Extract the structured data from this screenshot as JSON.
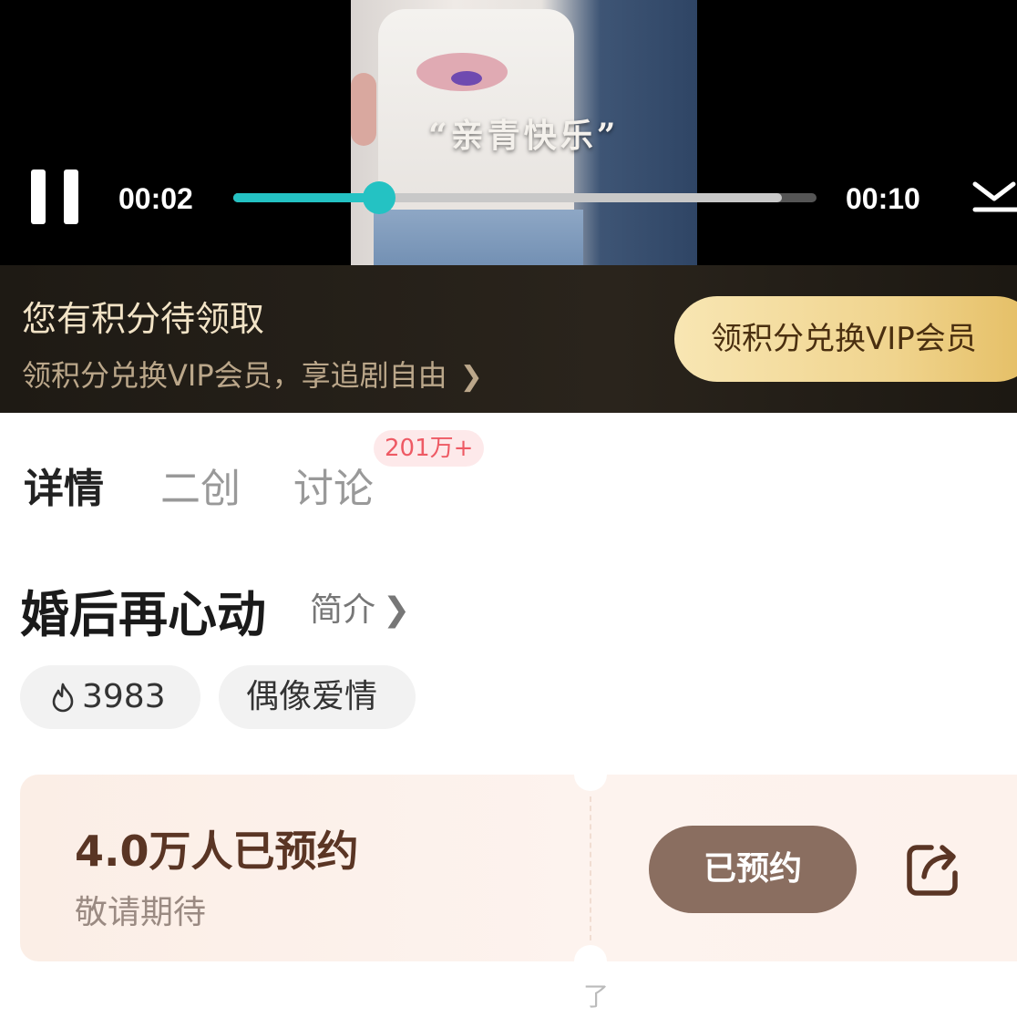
{
  "player": {
    "caption": "“亲青快乐”",
    "current_time": "00:02",
    "total_time": "00:10",
    "progress": 0.25,
    "buffered": 0.94,
    "state": "playing",
    "icons": [
      "pause-icon",
      "collapse-down-icon"
    ]
  },
  "banner": {
    "title": "您有积分待领取",
    "subtitle": "领积分兑换VIP会员，享追剧自由",
    "button": "领积分兑换VIP会员"
  },
  "tabs": [
    {
      "label": "详情",
      "active": true
    },
    {
      "label": "二创",
      "active": false
    },
    {
      "label": "讨论",
      "active": false,
      "badge": "201万+"
    }
  ],
  "show": {
    "title": "婚后再心动",
    "intro_link": "简介",
    "heat": "3983",
    "genre": "偶像爱情"
  },
  "reservation": {
    "count_text": "4.0万人已预约",
    "subtitle": "敬请期待",
    "button": "已预约"
  },
  "watermark": "了",
  "colors": {
    "accent_teal": "#24c2c3",
    "gold": "#f0d48e",
    "reserve_button": "#8a6e60",
    "badge_red": "#ee5a64"
  }
}
